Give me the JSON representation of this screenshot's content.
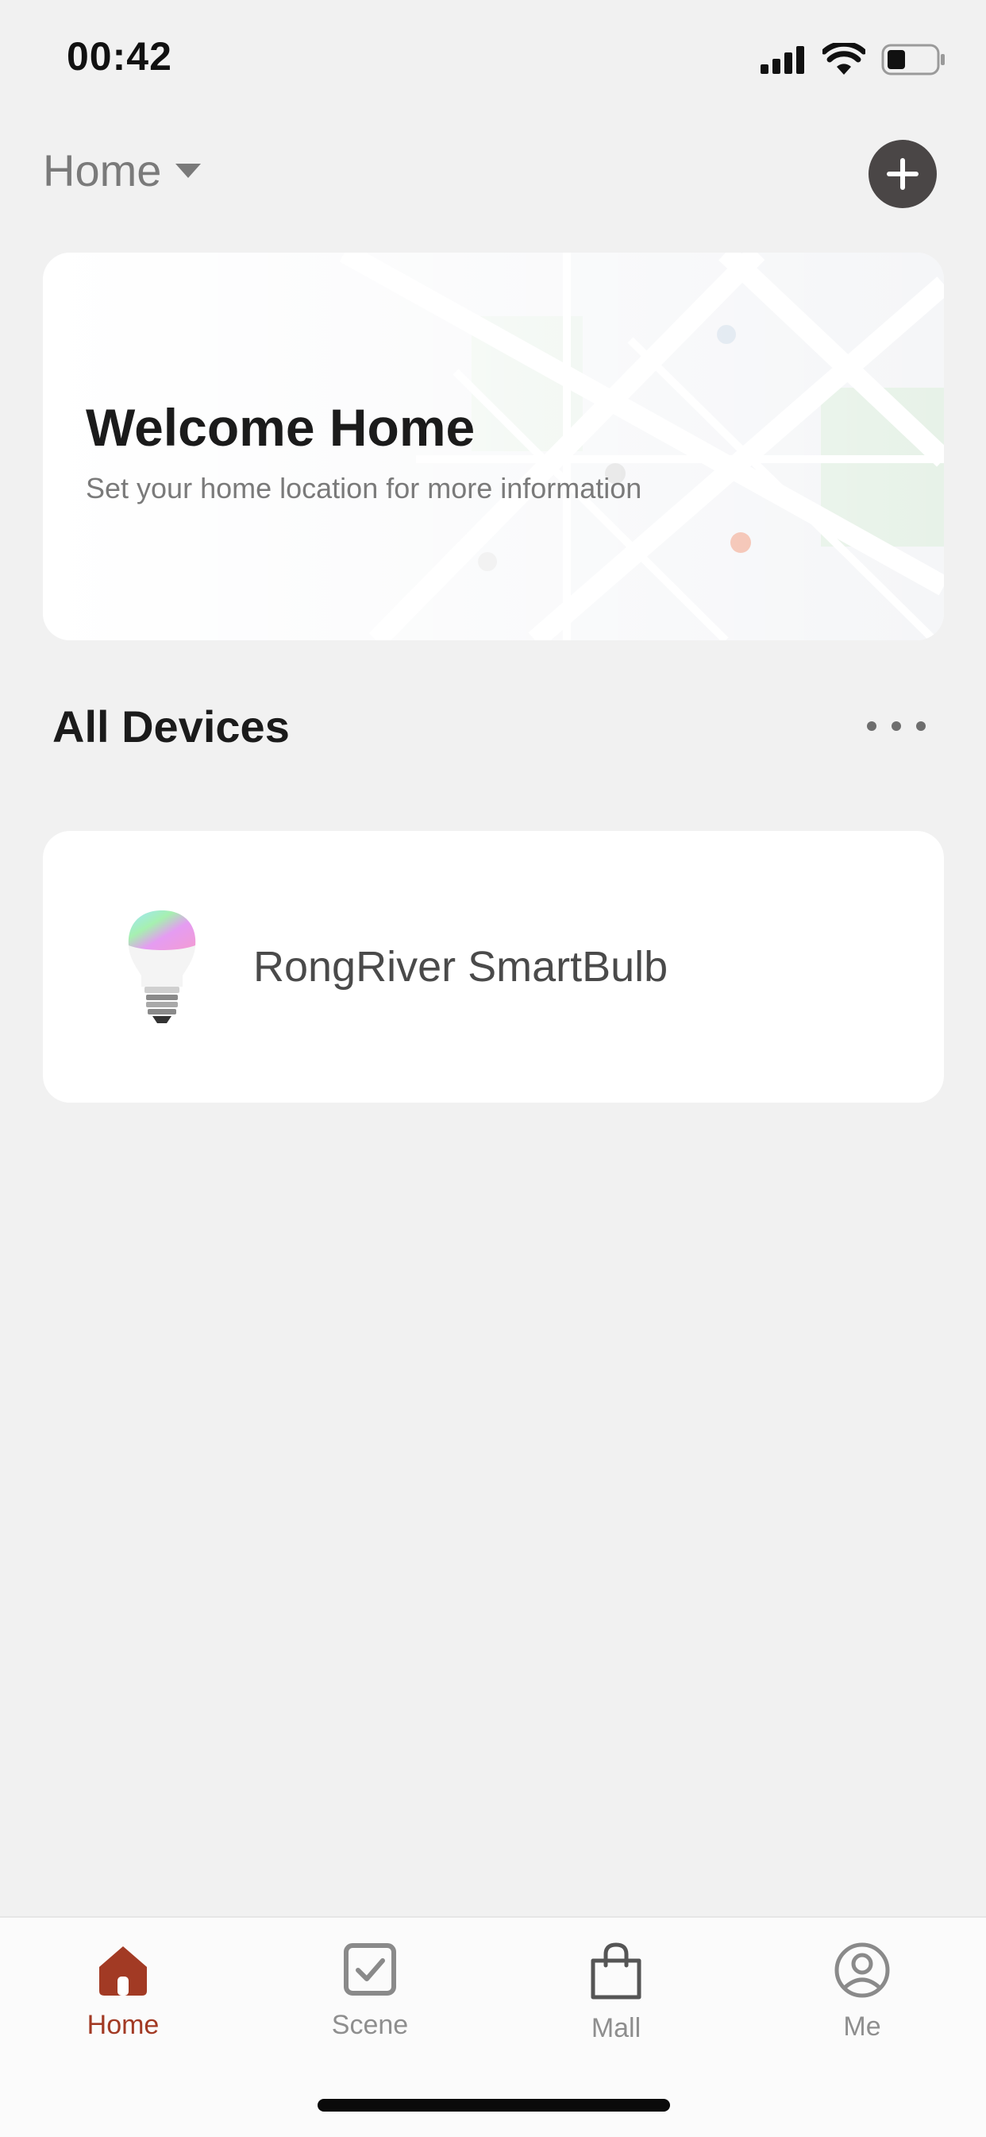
{
  "status_bar": {
    "time": "00:42",
    "icons": [
      "signal-icon",
      "wifi-icon",
      "battery-icon"
    ]
  },
  "header": {
    "home_label": "Home",
    "home_dropdown_icon": "caret-down-icon",
    "add_button_icon": "plus-icon"
  },
  "welcome_card": {
    "title": "Welcome Home",
    "subtitle": "Set your home location for more information"
  },
  "devices_section": {
    "title": "All Devices",
    "more_icon": "more-horizontal-icon"
  },
  "devices": [
    {
      "name": "RongRiver SmartBulb",
      "icon": "smart-bulb-icon"
    }
  ],
  "tabbar": {
    "tabs": [
      {
        "label": "Home",
        "icon": "home-icon",
        "active": true
      },
      {
        "label": "Scene",
        "icon": "scene-checkbox-icon",
        "active": false
      },
      {
        "label": "Mall",
        "icon": "shopping-bag-icon",
        "active": false
      },
      {
        "label": "Me",
        "icon": "profile-icon",
        "active": false
      }
    ]
  },
  "colors": {
    "background": "#f1f1f1",
    "card": "#ffffff",
    "accent": "#a23a24",
    "add_button": "#4a4646",
    "inactive_tab": "#8e8e8e"
  }
}
